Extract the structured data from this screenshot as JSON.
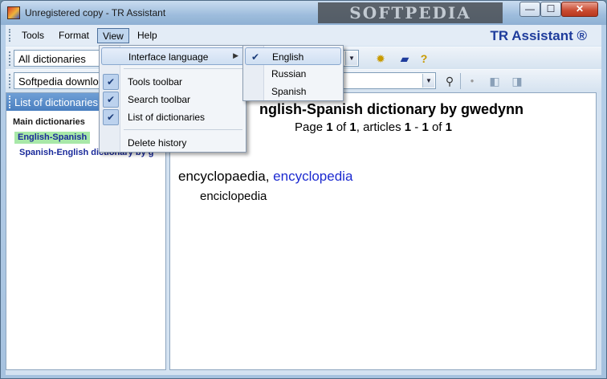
{
  "window": {
    "title": "Unregistered copy - TR Assistant",
    "watermark": "SOFTPEDIA",
    "minimize_glyph": "—",
    "maximize_glyph": "☐",
    "close_glyph": "✕"
  },
  "menubar": {
    "items": [
      {
        "label": "Tools"
      },
      {
        "label": "Format"
      },
      {
        "label": "View"
      },
      {
        "label": "Help"
      }
    ],
    "brand": "TR Assistant ®"
  },
  "toolbar1": {
    "dictionaries_combo": "All dictionaries",
    "icons": [
      "settings-gear-icon",
      "book-icon",
      "help-question-icon"
    ]
  },
  "toolbar2": {
    "search_combo": "Softpedia downlo",
    "icons": [
      "search-magnifier-icon",
      "stop-icon",
      "back-icon",
      "forward-icon"
    ]
  },
  "left_panel": {
    "header": "List of dictionaries",
    "group": "Main dictionaries",
    "items": [
      {
        "label": "English-Spanish"
      },
      {
        "label": "Spanish-English dictionary by g"
      }
    ]
  },
  "content": {
    "dict_title": "nglish-Spanish dictionary by gwedynn",
    "page_prefix": "Page ",
    "page_current": "1",
    "page_of": " of ",
    "page_total": "1",
    "articles_prefix": ", articles ",
    "articles_from": "1",
    "articles_dash": " - ",
    "articles_to": "1",
    "articles_of": " of ",
    "articles_total": "1",
    "headword": "encyclopaedia",
    "headword_sep": ", ",
    "headword_alt": "encyclopedia",
    "translation": "enciclopedia"
  },
  "view_menu": {
    "items": [
      {
        "label": "Interface language",
        "checked": false,
        "submenu": true
      },
      {
        "label": "Tools toolbar",
        "checked": true
      },
      {
        "label": "Search toolbar",
        "checked": true
      },
      {
        "label": "List of dictionaries",
        "checked": true
      },
      {
        "label": "Delete history",
        "checked": false
      }
    ]
  },
  "language_menu": {
    "items": [
      {
        "label": "English",
        "checked": true
      },
      {
        "label": "Russian",
        "checked": false
      },
      {
        "label": "Spanish",
        "checked": false
      }
    ]
  }
}
